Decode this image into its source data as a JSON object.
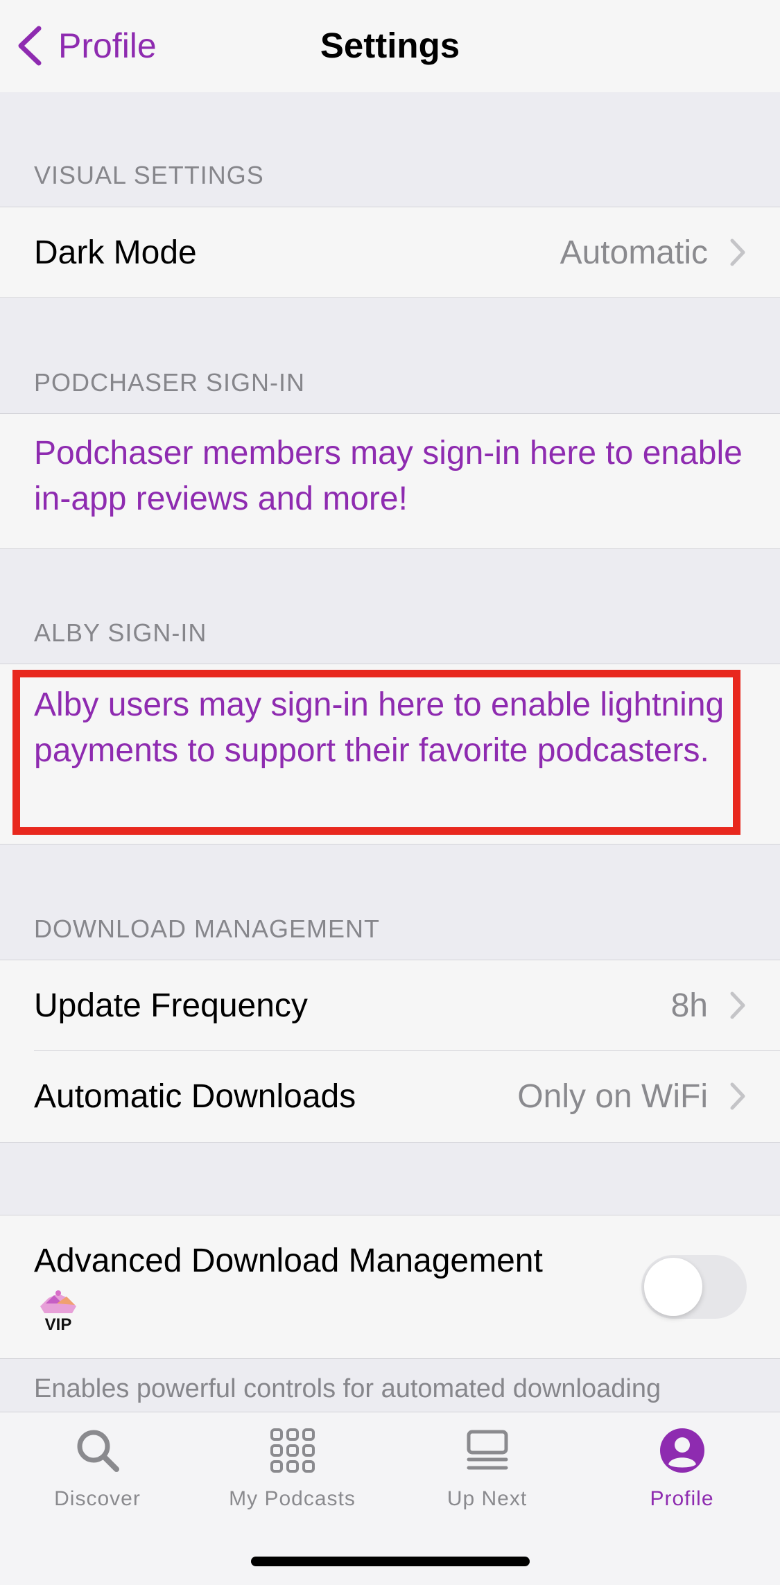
{
  "nav": {
    "back_label": "Profile",
    "title": "Settings"
  },
  "sections": {
    "visual": {
      "header": "VISUAL SETTINGS",
      "dark_mode_label": "Dark Mode",
      "dark_mode_value": "Automatic"
    },
    "podchaser": {
      "header": "PODCHASER SIGN-IN",
      "text": "Podchaser members may sign-in here to enable in-app reviews and more!"
    },
    "alby": {
      "header": "ALBY SIGN-IN",
      "text": "Alby users may sign-in here to enable lightning payments to support their favorite podcasters."
    },
    "download": {
      "header": "DOWNLOAD MANAGEMENT",
      "update_label": "Update Frequency",
      "update_value": "8h",
      "auto_label": "Automatic Downloads",
      "auto_value": "Only on WiFi"
    },
    "advanced": {
      "label": "Advanced Download Management",
      "vip_badge": "VIP",
      "toggle_on": false,
      "footer": "Enables powerful controls for automated downloading"
    }
  },
  "tabs": [
    {
      "label": "Discover",
      "icon": "search-icon"
    },
    {
      "label": "My Podcasts",
      "icon": "grid-icon"
    },
    {
      "label": "Up Next",
      "icon": "queue-icon"
    },
    {
      "label": "Profile",
      "icon": "profile-icon",
      "active": true
    }
  ],
  "colors": {
    "accent": "#8e2bb0",
    "highlight": "#e8281e",
    "secondary_text": "#8a8a8e"
  }
}
